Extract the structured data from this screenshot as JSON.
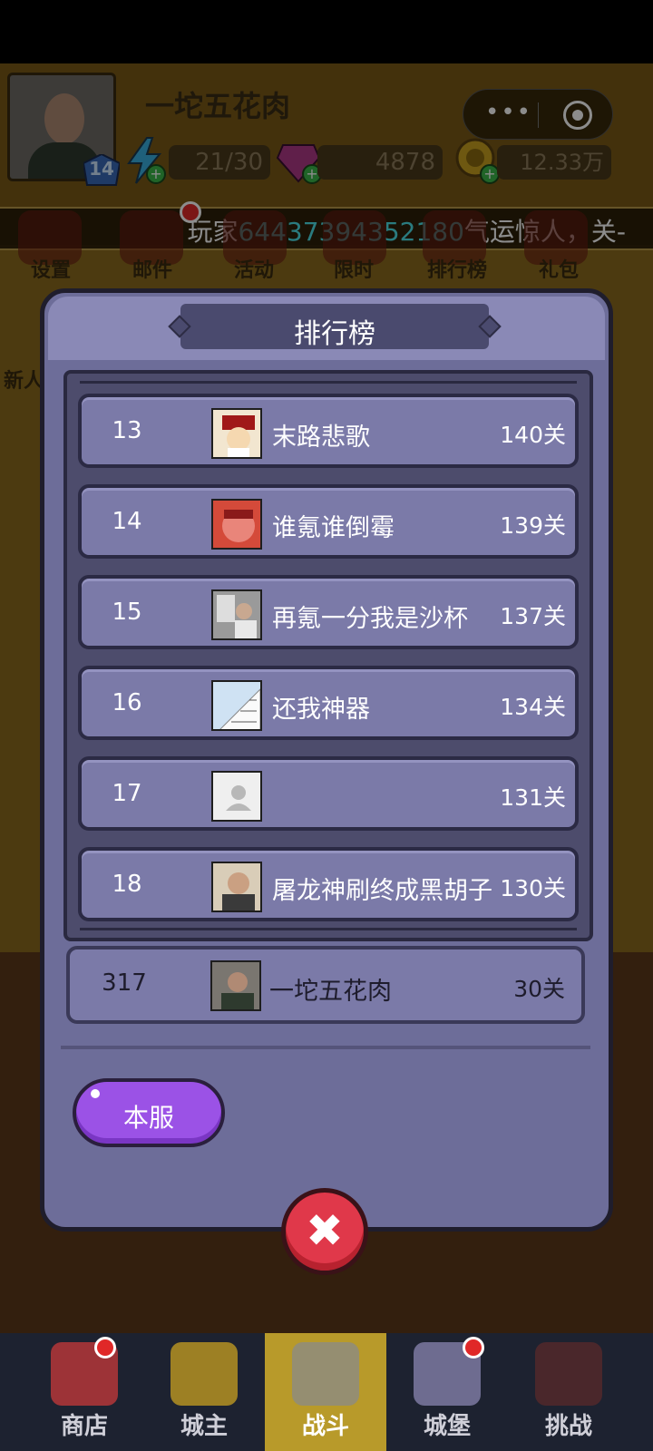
{
  "header": {
    "player_name": "一坨五花肉",
    "level": "14",
    "energy": "21/30",
    "gems": "4878",
    "gold": "12.33万"
  },
  "marquee": {
    "prefix": "玩家",
    "player_id": "64437394352180",
    "suffix": "气运惊人，关-"
  },
  "top_menu": [
    "设置",
    "邮件",
    "活动",
    "限时",
    "排行榜",
    "礼包"
  ],
  "side_label": "新人",
  "leaderboard": {
    "title": "排行榜",
    "rows": [
      {
        "rank": "13",
        "name": "末路悲歌",
        "score": "140关"
      },
      {
        "rank": "14",
        "name": "谁氪谁倒霉",
        "score": "139关"
      },
      {
        "rank": "15",
        "name": "再氪一分我是沙杯",
        "score": "137关"
      },
      {
        "rank": "16",
        "name": "还我神器",
        "score": "134关"
      },
      {
        "rank": "17",
        "name": "",
        "score": "131关"
      },
      {
        "rank": "18",
        "name": "屠龙神刷终成黑胡子",
        "score": "130关"
      }
    ],
    "self": {
      "rank": "317",
      "name": "一坨五花肉",
      "score": "30关"
    },
    "server_button": "本服"
  },
  "bottom_nav": [
    {
      "label": "商店",
      "icon": "shop-icon"
    },
    {
      "label": "城主",
      "icon": "crown-icon"
    },
    {
      "label": "战斗",
      "icon": "crossed-swords-icon"
    },
    {
      "label": "城堡",
      "icon": "castle-icon"
    },
    {
      "label": "挑战",
      "icon": "devil-icon"
    }
  ],
  "colors": {
    "modal_bg": "#6d6d99",
    "row_bg": "#7b7aa8",
    "highlight_id": "#4ee0e8",
    "server_button": "#9b52e6",
    "close_button": "#e0384a",
    "nav_active": "#b89a2a"
  }
}
